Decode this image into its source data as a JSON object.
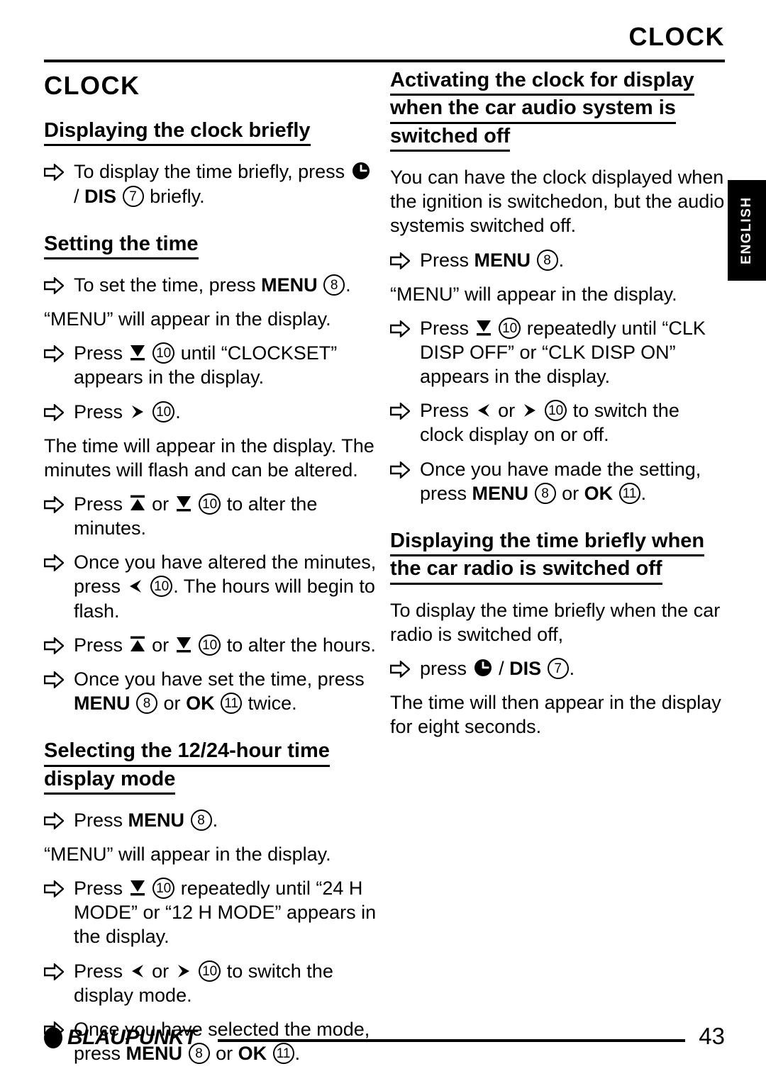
{
  "running_head": "CLOCK",
  "side_tab": {
    "label": "ENGLISH"
  },
  "chapter_title": "CLOCK",
  "left_column": {
    "section1": {
      "heading": "Displaying the clock briefly",
      "step1_a": "To display the time briefly, press",
      "step1_icon": "clock-icon",
      "step1_b": "/",
      "step1_key": "DIS",
      "step1_ref": "7",
      "step1_c": "briefly."
    },
    "section2": {
      "heading": "Setting the time",
      "step1_a": "To set the time, press",
      "step1_key": "MENU",
      "step1_ref": "8",
      "step1_b": ".",
      "para1": "“MENU” will appear in the display.",
      "step2_a": "Press",
      "step2_icon": "arrow-down-bar-icon",
      "step2_ref": "10",
      "step2_b": "until “CLOCKSET” appears in the display.",
      "step3_a": "Press",
      "step3_icon": "arrow-right-solid-icon",
      "step3_ref": "10",
      "step3_b": ".",
      "para2": "The time will appear in the display. The minutes will flash and can be altered.",
      "step4_a": "Press",
      "step4_icon1": "arrow-up-bar-icon",
      "step4_or": "or",
      "step4_icon2": "arrow-down-bar-icon",
      "step4_ref": "10",
      "step4_b": "to alter the minutes.",
      "step5_a": "Once you have altered the minutes, press",
      "step5_icon": "arrow-left-solid-icon",
      "step5_ref": "10",
      "step5_b": ". The hours will begin to flash.",
      "step6_a": "Press",
      "step6_icon1": "arrow-up-bar-icon",
      "step6_or": "or",
      "step6_icon2": "arrow-down-bar-icon",
      "step6_ref": "10",
      "step6_b": "to alter the hours.",
      "step7_a": "Once you have set the time, press",
      "step7_key1": "MENU",
      "step7_ref1": "8",
      "step7_or": "or",
      "step7_key2": "OK",
      "step7_ref2": "11",
      "step7_b": "twice."
    },
    "section3": {
      "heading_line1": "Selecting the 12/24-hour time",
      "heading_line2": "display mode",
      "step1_a": "Press",
      "step1_key": "MENU",
      "step1_ref": "8",
      "step1_b": ".",
      "para1": "“MENU” will appear in the display.",
      "step2_a": "Press",
      "step2_icon": "arrow-down-bar-icon",
      "step2_ref": "10",
      "step2_b": "repeatedly until “24 H MODE” or “12 H MODE” appears in the display.",
      "step3_a": "Press",
      "step3_icon1": "arrow-left-solid-icon",
      "step3_or": "or",
      "step3_icon2": "arrow-right-solid-icon",
      "step3_ref": "10",
      "step3_b": "to switch the display mode.",
      "step4_a": "Once you have selected the mode, press",
      "step4_key1": "MENU",
      "step4_ref1": "8",
      "step4_or": "or",
      "step4_key2": "OK",
      "step4_ref2": "11",
      "step4_b": "."
    }
  },
  "right_column": {
    "section1": {
      "heading_line1": "Activating the clock for display",
      "heading_line2": "when the car audio system is",
      "heading_line3": "switched off",
      "para1": "You can have the clock displayed when the ignition is switchedon, but the audio systemis switched off.",
      "step1_a": "Press",
      "step1_key": "MENU",
      "step1_ref": "8",
      "step1_b": ".",
      "para2": "“MENU” will appear in the display.",
      "step2_a": "Press",
      "step2_icon": "arrow-down-bar-icon",
      "step2_ref": "10",
      "step2_b": "repeatedly until “CLK DISP OFF” or “CLK DISP ON” appears in the display.",
      "step3_a": "Press",
      "step3_icon1": "arrow-left-solid-icon",
      "step3_or": "or",
      "step3_icon2": "arrow-right-solid-icon",
      "step3_ref": "10",
      "step3_b": "to switch the clock display on or off.",
      "step4_a": "Once you have made the setting, press",
      "step4_key1": "MENU",
      "step4_ref1": "8",
      "step4_or": "or",
      "step4_key2": "OK",
      "step4_ref2": "11",
      "step4_b": "."
    },
    "section2": {
      "heading_line1": "Displaying the time briefly when",
      "heading_line2": "the car radio is switched off",
      "para1": "To display the time briefly when the car radio is switched off,",
      "step1_a": "press",
      "step1_icon": "clock-icon",
      "step1_b": "/",
      "step1_key": "DIS",
      "step1_ref": "7",
      "step1_c": ".",
      "para2": "The time will then appear in the display for eight seconds."
    }
  },
  "footer": {
    "brand": "BLAUPUNKT",
    "page_number": "43"
  }
}
